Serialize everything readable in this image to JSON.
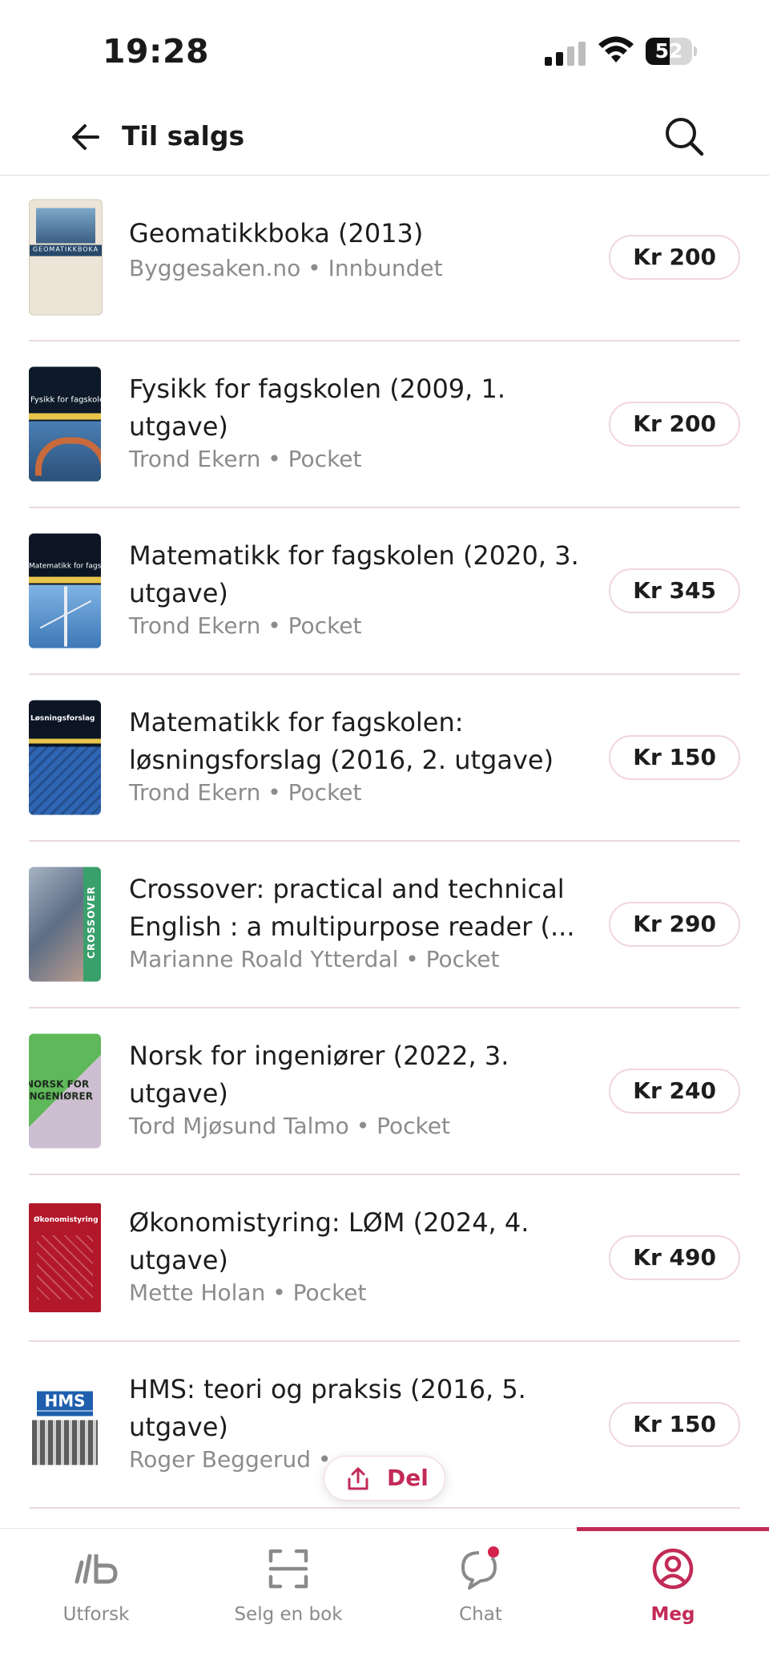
{
  "status_bar": {
    "time": "19:28",
    "battery": "52"
  },
  "header": {
    "title": "Til salgs"
  },
  "books": [
    {
      "title": "Geomatikkboka (2013)",
      "meta": "Byggesaken.no • Innbundet",
      "price": "Kr 200",
      "cover_text": "GEOMATIKKBOKA"
    },
    {
      "title": "Fysikk for fagskolen (2009, 1. utgave)",
      "meta": "Trond Ekern • Pocket",
      "price": "Kr 200",
      "cover_text": "Fysikk for fagskolen"
    },
    {
      "title": "Matematikk for fagskolen (2020, 3. utgave)",
      "meta": "Trond Ekern • Pocket",
      "price": "Kr 345",
      "cover_text": "Matematikk for fagskolen"
    },
    {
      "title": "Matematikk for fagskolen: løsningsforslag (2016, 2. utgave)",
      "meta": "Trond Ekern • Pocket",
      "price": "Kr 150",
      "cover_text": "Løsningsforslag"
    },
    {
      "title": "Crossover: practical and technical English : a multipurpose reader (...",
      "meta": "Marianne Roald Ytterdal • Pocket",
      "price": "Kr 290",
      "cover_text": "CROSSOVER"
    },
    {
      "title": "Norsk for ingeniører (2022, 3. utgave)",
      "meta": "Tord Mjøsund Talmo • Pocket",
      "price": "Kr 240",
      "cover_text": "NORSK FOR INGENIØRER"
    },
    {
      "title": "Økonomistyring: LØM (2024, 4. utgave)",
      "meta": "Mette Holan • Pocket",
      "price": "Kr 490",
      "cover_text": "Økonomistyring"
    },
    {
      "title": "HMS: teori og praksis (2016, 5. utgave)",
      "meta": "Roger Beggerud •",
      "price": "Kr 150",
      "cover_text": "HMS"
    }
  ],
  "share": {
    "label": "Del"
  },
  "tabbar": {
    "items": [
      {
        "label": "Utforsk",
        "icon": "lb-logo-icon"
      },
      {
        "label": "Selg en bok",
        "icon": "scan-icon"
      },
      {
        "label": "Chat",
        "icon": "chat-icon"
      },
      {
        "label": "Meg",
        "icon": "profile-icon"
      }
    ],
    "active": "Meg"
  },
  "colors": {
    "accent": "#c22a57",
    "pill_border": "#f0d6dd",
    "divider": "#ecd9df"
  }
}
